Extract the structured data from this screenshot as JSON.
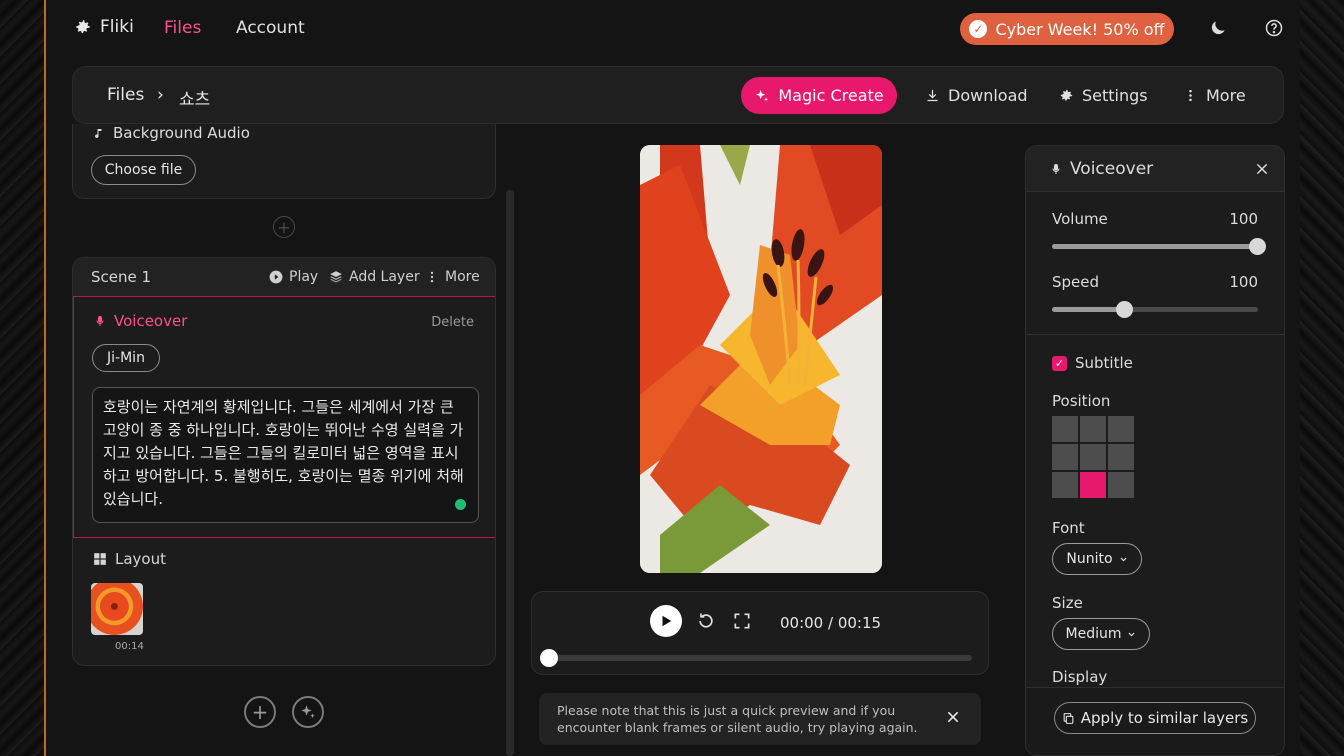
{
  "nav": {
    "brand": "Fliki",
    "links": [
      "Files",
      "Account"
    ],
    "promo": "Cyber Week! 50% off"
  },
  "toolbar": {
    "breadcrumb_root": "Files",
    "breadcrumb_separator": "›",
    "breadcrumb_current": "쇼츠",
    "magic_create": "Magic Create",
    "download": "Download",
    "settings": "Settings",
    "more": "More"
  },
  "left": {
    "background_audio_label": "Background Audio",
    "choose_file": "Choose file",
    "scene": {
      "title": "Scene 1",
      "play": "Play",
      "add_layer": "Add Layer",
      "more": "More"
    },
    "voiceover": {
      "title": "Voiceover",
      "delete": "Delete",
      "voice": "Ji-Min",
      "text": "호랑이는 자연계의 황제입니다. 그들은 세계에서 가장 큰 고양이 종 중 하나입니다. 호랑이는 뛰어난 수영 실력을 가지고 있습니다. 그들은 그들의 킬로미터 넓은 영역을 표시하고 방어합니다. 5. 불행히도, 호랑이는 멸종 위기에 처해 있습니다."
    },
    "layout_label": "Layout",
    "thumb_time": "00:14"
  },
  "player": {
    "timecode": "00:00 / 00:15",
    "progress": 0
  },
  "notice": "Please note that this is just a quick preview and if you encounter blank frames or silent audio, try playing again.",
  "panel": {
    "title": "Voiceover",
    "volume_label": "Volume",
    "volume_value": "100",
    "volume_level": 1.0,
    "speed_label": "Speed",
    "speed_value": "100",
    "speed_level": 0.35,
    "subtitle_label": "Subtitle",
    "subtitle_checked": true,
    "position_label": "Position",
    "position_selected": "bottom-center",
    "font_label": "Font",
    "font_value": "Nunito",
    "size_label": "Size",
    "size_value": "Medium",
    "display_label": "Display",
    "apply_button": "Apply to similar layers"
  },
  "colors": {
    "accent": "#e8186c",
    "active_link": "#ff4f93",
    "promo": "#e0613f",
    "status_dot": "#1fbf74"
  }
}
